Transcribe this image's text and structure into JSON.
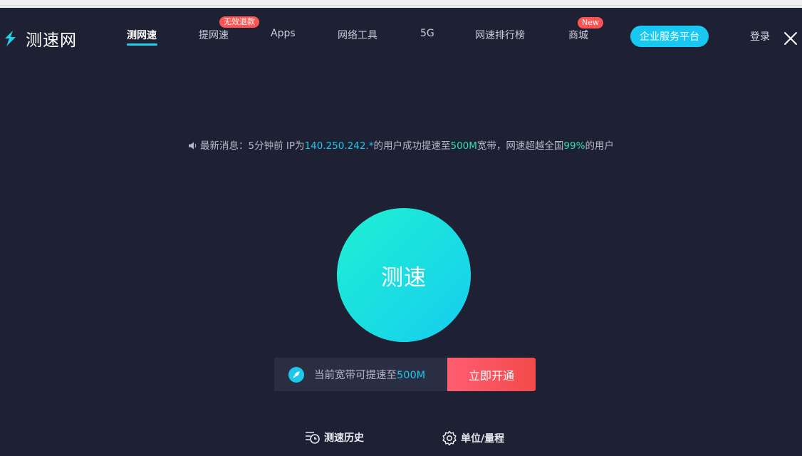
{
  "logo": {
    "text": "测速网"
  },
  "nav": {
    "items": [
      {
        "label": "测网速",
        "active": true
      },
      {
        "label": "提网速"
      },
      {
        "label": "Apps"
      },
      {
        "label": "网络工具"
      },
      {
        "label": "5G"
      },
      {
        "label": "网速排行榜"
      },
      {
        "label": "商城"
      }
    ],
    "badge_refund": "无效退款",
    "badge_new": "New",
    "enterprise": "企业服务平台",
    "login": "登录"
  },
  "message": {
    "prefix": "最新消息：5分钟前 IP为",
    "ip": "140.250.242.*",
    "middle": "的用户成功提速至",
    "speed": "500M",
    "middle2": "宽带，网速超越全国",
    "percent": "99%",
    "suffix": "的用户"
  },
  "speed_button": {
    "label": "测速"
  },
  "upgrade": {
    "text_prefix": "当前宽带可提速至",
    "value": "500M",
    "button": "立即开通"
  },
  "bottom": {
    "history": "测速历史",
    "units": "单位/量程"
  },
  "colors": {
    "background": "#1e2133",
    "accent_cyan": "#1fc8ea",
    "accent_green": "#2fe0b0",
    "badge_red": "#ff5252"
  }
}
